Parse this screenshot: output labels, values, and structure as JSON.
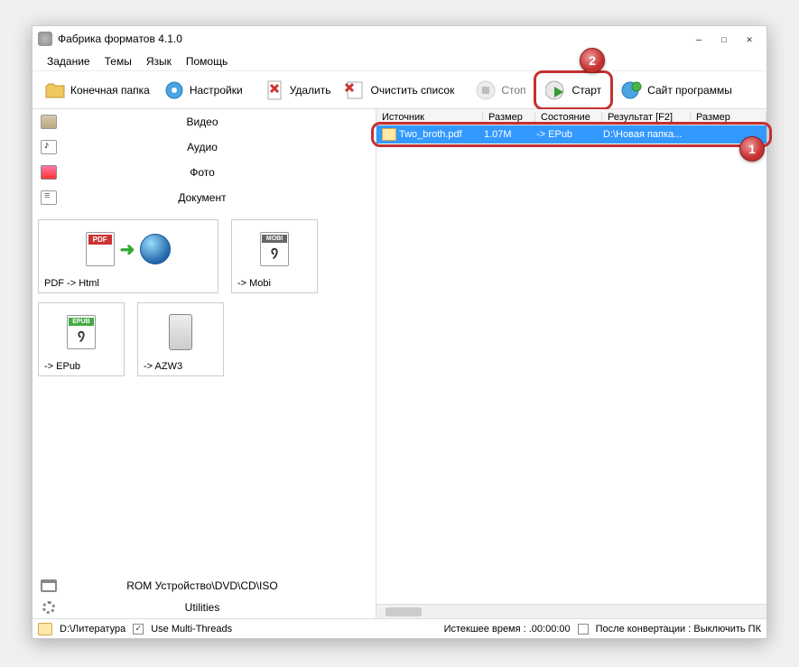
{
  "window": {
    "title": "Фабрика форматов 4.1.0"
  },
  "menu": {
    "task": "Задание",
    "themes": "Темы",
    "lang": "Язык",
    "help": "Помощь"
  },
  "toolbar": {
    "outfolder": "Конечная папка",
    "settings": "Настройки",
    "delete": "Удалить",
    "clear": "Очистить список",
    "stop": "Стоп",
    "start": "Старт",
    "site": "Сайт программы"
  },
  "categories": {
    "video": "Видео",
    "audio": "Аудио",
    "photo": "Фото",
    "document": "Документ"
  },
  "conversions": {
    "pdf_html": "PDF -> Html",
    "mobi": "-> Mobi",
    "epub": "-> EPub",
    "azw3": "-> AZW3"
  },
  "bottom": {
    "rom": "ROM Устройство\\DVD\\CD\\ISO",
    "util": "Utilities"
  },
  "file_header": {
    "source": "Источник",
    "size": "Размер",
    "state": "Состояние",
    "result": "Результат [F2]",
    "size2": "Размер"
  },
  "file_row": {
    "name": "Two_broth.pdf",
    "size": "1.07M",
    "state": "-> EPub",
    "result": "D:\\Новая папка..."
  },
  "status": {
    "path": "D:\\Литература",
    "multithreads": "Use Multi-Threads",
    "elapsed": "Истекшее время : .00:00:00",
    "after_conv": "После конвертации : Выключить ПК"
  },
  "callouts": {
    "one": "1",
    "two": "2"
  }
}
